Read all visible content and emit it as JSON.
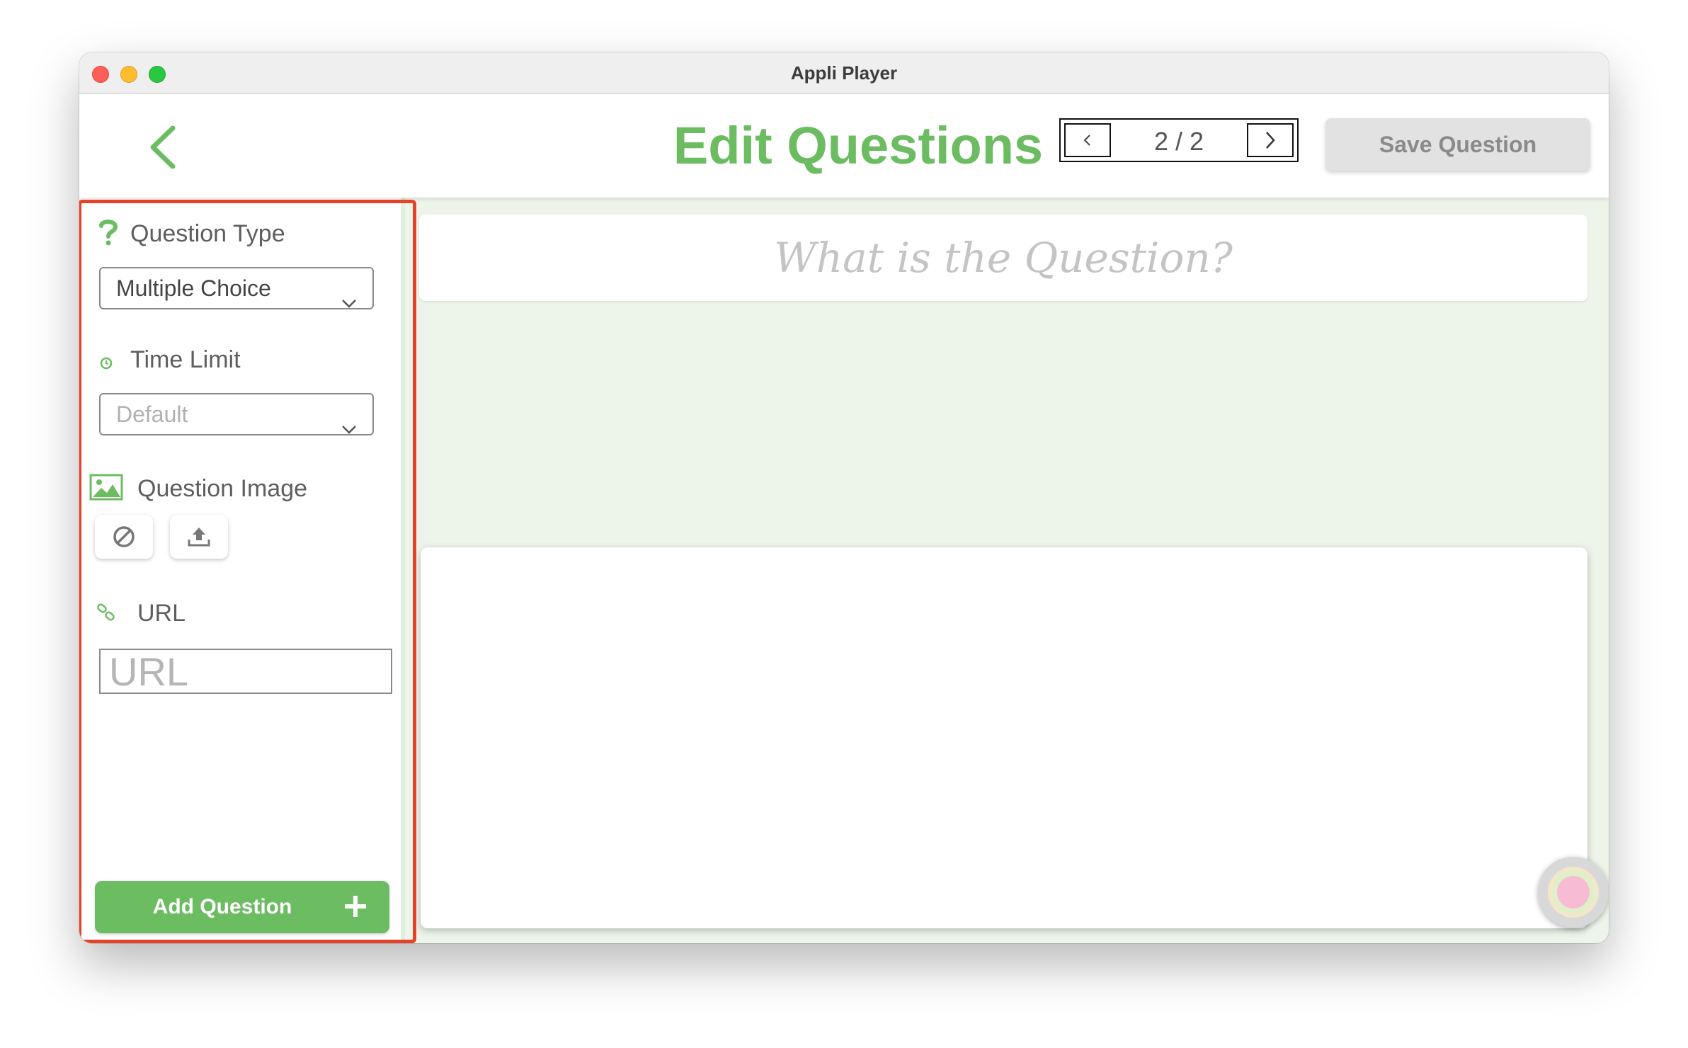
{
  "window": {
    "title": "Appli Player"
  },
  "header": {
    "title": "Edit Questions",
    "pager": {
      "label": "2 / 2",
      "prev_icon": "chevron-left-icon",
      "next_icon": "chevron-right-icon"
    },
    "save_label": "Save Question",
    "back_icon": "chevron-left-icon"
  },
  "sidebar": {
    "question_type": {
      "label": "Question Type",
      "icon": "question-mark-icon",
      "value": "Multiple Choice"
    },
    "time_limit": {
      "label": "Time Limit",
      "icon": "clock-icon",
      "value": "Default"
    },
    "question_image": {
      "label": "Question Image",
      "icon": "image-icon",
      "remove_icon": "prohibit-icon",
      "upload_icon": "upload-icon"
    },
    "url": {
      "label": "URL",
      "icon": "link-icon",
      "placeholder": "URL"
    },
    "add_question": {
      "label": "Add Question",
      "icon": "plus-icon"
    }
  },
  "content": {
    "question_placeholder": "What is the Question?"
  },
  "colors": {
    "accent": "#6cbc62",
    "content_bg": "#edf5ea",
    "highlight": "#e8412a"
  }
}
